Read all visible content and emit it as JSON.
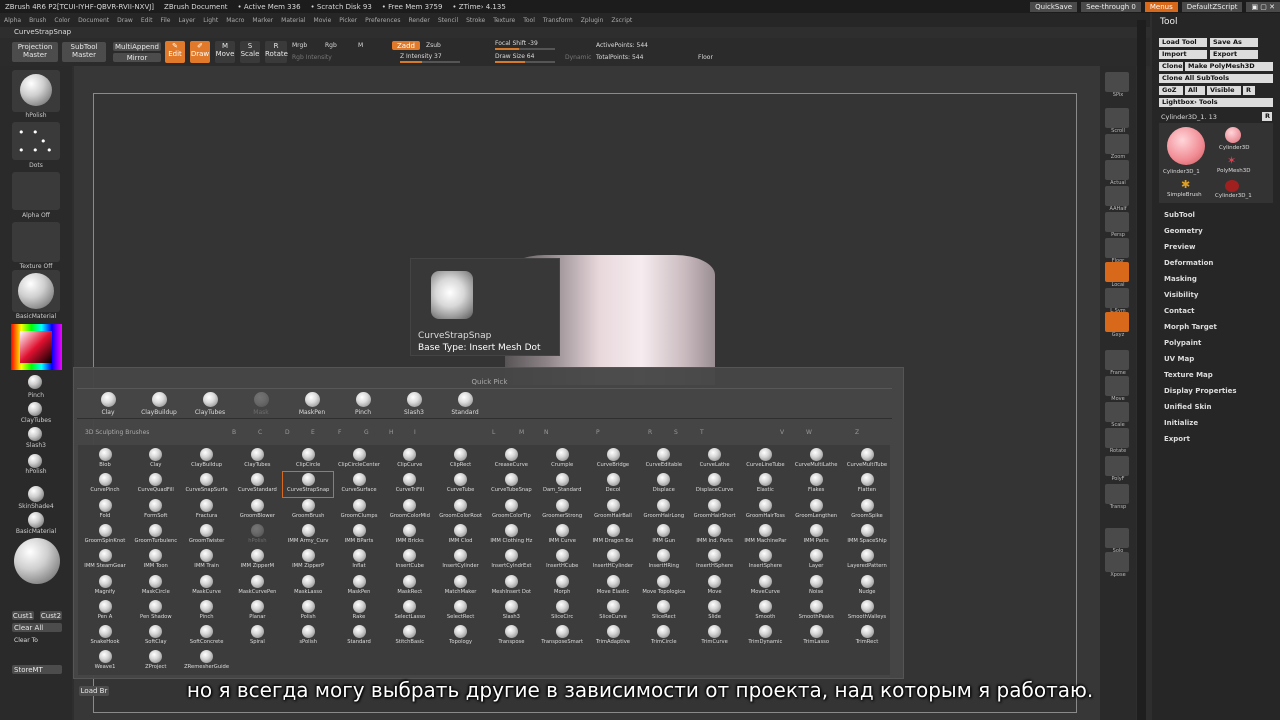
{
  "titlebar": {
    "app": "ZBrush 4R6 P2[TCUI-IYHF-QBVR-RVII-NXVJ]",
    "doc": "ZBrush Document",
    "active_mem": "• Active Mem 336",
    "scratch": "• Scratch Disk 93",
    "free_mem": "• Free Mem 3759",
    "ztime": "• ZTime› 4.135",
    "quicksave": "QuickSave",
    "seethrough": "See-through 0",
    "menus": "Menus",
    "defaultzscript": "DefaultZScript"
  },
  "menus": [
    "Alpha",
    "Brush",
    "Color",
    "Document",
    "Draw",
    "Edit",
    "File",
    "Layer",
    "Light",
    "Macro",
    "Marker",
    "Material",
    "Movie",
    "Picker",
    "Preferences",
    "Render",
    "Stencil",
    "Stroke",
    "Texture",
    "Tool",
    "Transform",
    "Zplugin",
    "Zscript"
  ],
  "brush_name": "CurveStrapSnap",
  "top": {
    "projection": "Projection",
    "master": "Master",
    "subtool": "SubTool",
    "subtool_master": "Master",
    "multiappend": "MultiAppend",
    "mirror": "Mirror",
    "edit": "Edit",
    "draw": "Draw",
    "move": "Move",
    "scale": "Scale",
    "rotate": "Rotate",
    "mrgb": "Mrgb",
    "rgb": "Rgb",
    "m": "M",
    "zadd": "Zadd",
    "zsub": "Zsub",
    "rgb_intensity": "Rgb Intensity",
    "z_intensity": "Z Intensity 37",
    "focal_shift": "Focal Shift -39",
    "draw_size": "Draw Size 64",
    "dynamic": "Dynamic",
    "active_points": "ActivePoints: 544",
    "total_points": "TotalPoints: 544",
    "floor": "Floor"
  },
  "left": {
    "hpolish": "hPolish",
    "dots": "Dots",
    "alpha_off": "Alpha Off",
    "texture_off": "Texture Off",
    "basic_material": "BasicMaterial",
    "pinch": "Pinch",
    "claytubes": "ClayTubes",
    "slash3": "Slash3",
    "hpolish2": "hPolish",
    "skinshade4": "SkinShade4",
    "basic_material2": "BasicMaterial",
    "cust1": "Cust1",
    "cust2": "Cust2",
    "clear_all": "Clear All",
    "clear_to": "Clear To",
    "storemt": "StoreMT",
    "load_br": "Load Br"
  },
  "tooltip": {
    "name": "CurveStrapSnap",
    "base_type": "Base Type: Insert Mesh Dot"
  },
  "popup": {
    "quick_pick": "Quick Pick",
    "sculpting_header": "3D Sculpting Brushes",
    "letters": [
      "B",
      "C",
      "D",
      "E",
      "F",
      "G",
      "H",
      "I",
      "L",
      "M",
      "N",
      "P",
      "R",
      "S",
      "T",
      "V",
      "W",
      "Z"
    ],
    "quick": [
      "Clay",
      "ClayBuildup",
      "ClayTubes",
      "Mask",
      "MaskPen",
      "Pinch",
      "Slash3",
      "Standard"
    ],
    "brushes": [
      [
        "Blob",
        "Clay",
        "ClayBuildup",
        "ClayTubes",
        "ClipCircle",
        "ClipCircleCenter",
        "ClipCurve",
        "ClipRect",
        "CreaseCurve",
        "Crumple",
        "CurveBridge",
        "CurveEditable",
        "CurveLathe",
        "CurveLineTube",
        "CurveMultiLathe",
        "CurveMultiTube"
      ],
      [
        "CurvePinch",
        "CurveQuadFill",
        "CurveSnapSurfa",
        "CurveStandard",
        "CurveStrapSnap",
        "CurveSurface",
        "CurveTriFill",
        "CurveTube",
        "CurveTubeSnap",
        "Dam_Standard",
        "Decol",
        "Displace",
        "DisplaceCurve",
        "Elastic",
        "Flakes",
        "Flatten"
      ],
      [
        "Fold",
        "FormSoft",
        "Fractura",
        "GroomBlower",
        "GroomBrush",
        "GroomClumps",
        "GroomColorMid",
        "GroomColorRoot",
        "GroomColorTip",
        "GroomerStrong",
        "GroomHairBall",
        "GroomHairLong",
        "GroomHairShort",
        "GroomHairToss",
        "GroomLengthen",
        "GroomSpike"
      ],
      [
        "GroomSpinKnot",
        "GroomTurbulenc",
        "GroomTwister",
        "hPolish",
        "IMM Army_Curv",
        "IMM BParts",
        "IMM Bricks",
        "IMM Clod",
        "IMM Clothing Hz",
        "IMM Curve",
        "IMM Dragon Boi",
        "IMM Gun",
        "IMM Ind. Parts",
        "IMM MachinePar",
        "IMM Parts",
        "IMM SpaceShip"
      ],
      [
        "IMM SteamGear",
        "IMM Toon",
        "IMM Train",
        "IMM ZipperM",
        "IMM ZipperP",
        "Inflat",
        "InsertCube",
        "InsertCylinder",
        "InsertCylndrExt",
        "InsertHCube",
        "InsertHCylinder",
        "InsertHRing",
        "InsertHSphere",
        "InsertSphere",
        "Layer",
        "LayeredPattern"
      ],
      [
        "Magnify",
        "MaskCircle",
        "MaskCurve",
        "MaskCurvePen",
        "MaskLasso",
        "MaskPen",
        "MaskRect",
        "MatchMaker",
        "MeshInsert Dot",
        "Morph",
        "Move Elastic",
        "Move Topologica",
        "Move",
        "MoveCurve",
        "Noise",
        "Nudge"
      ],
      [
        "Pen A",
        "Pen Shadow",
        "Pinch",
        "Planar",
        "Polish",
        "Rake",
        "SelectLasso",
        "SelectRect",
        "Slash3",
        "SliceCirc",
        "SliceCurve",
        "SliceRect",
        "Slide",
        "Smooth",
        "SmoothPeaks",
        "SmoothValleys"
      ],
      [
        "SnakeHook",
        "SoftClay",
        "SoftConcrete",
        "Spiral",
        "sPolish",
        "Standard",
        "StitchBasic",
        "Topology",
        "Transpose",
        "TransposeSmart",
        "TrimAdaptive",
        "TrimCircle",
        "TrimCurve",
        "TrimDynamic",
        "TrimLasso",
        "TrimRect"
      ],
      [
        "Weave1",
        "ZProject",
        "ZRemesherGuide"
      ]
    ]
  },
  "rightshelf": [
    "SPix",
    "Scroll",
    "Zoom",
    "Actual",
    "AAHalf",
    "Persp",
    "Floor",
    "Local",
    "L.Sym",
    "Gxyz",
    "Frame",
    "Move",
    "Scale",
    "Rotate",
    "PolyF",
    "Transp",
    "Solo",
    "Xpose"
  ],
  "toolpanel": {
    "title": "Tool",
    "load_tool": "Load Tool",
    "save_as": "Save As",
    "import": "Import",
    "export": "Export",
    "clone": "Clone",
    "make_polymesh": "Make PolyMesh3D",
    "clone_all": "Clone All SubTools",
    "goz": "GoZ",
    "all": "All",
    "visible": "Visible",
    "r": "R",
    "lightbox": "Lightbox› Tools",
    "current": "Cylinder3D_1. 13",
    "r2": "R",
    "thumbs": [
      "Cylinder3D_1",
      "Cylinder3D",
      "PolyMesh3D",
      "SimpleBrush",
      "Cylinder3D_1"
    ],
    "sections": [
      "SubTool",
      "Geometry",
      "Preview",
      "Deformation",
      "Masking",
      "Visibility",
      "Contact",
      "Morph Target",
      "Polypaint",
      "UV Map",
      "Texture Map",
      "Display Properties",
      "Unified Skin",
      "Initialize",
      "Export"
    ]
  },
  "subtitle": "но я всегда могу выбрать другие в зависимости от проекта, над которым я работаю."
}
